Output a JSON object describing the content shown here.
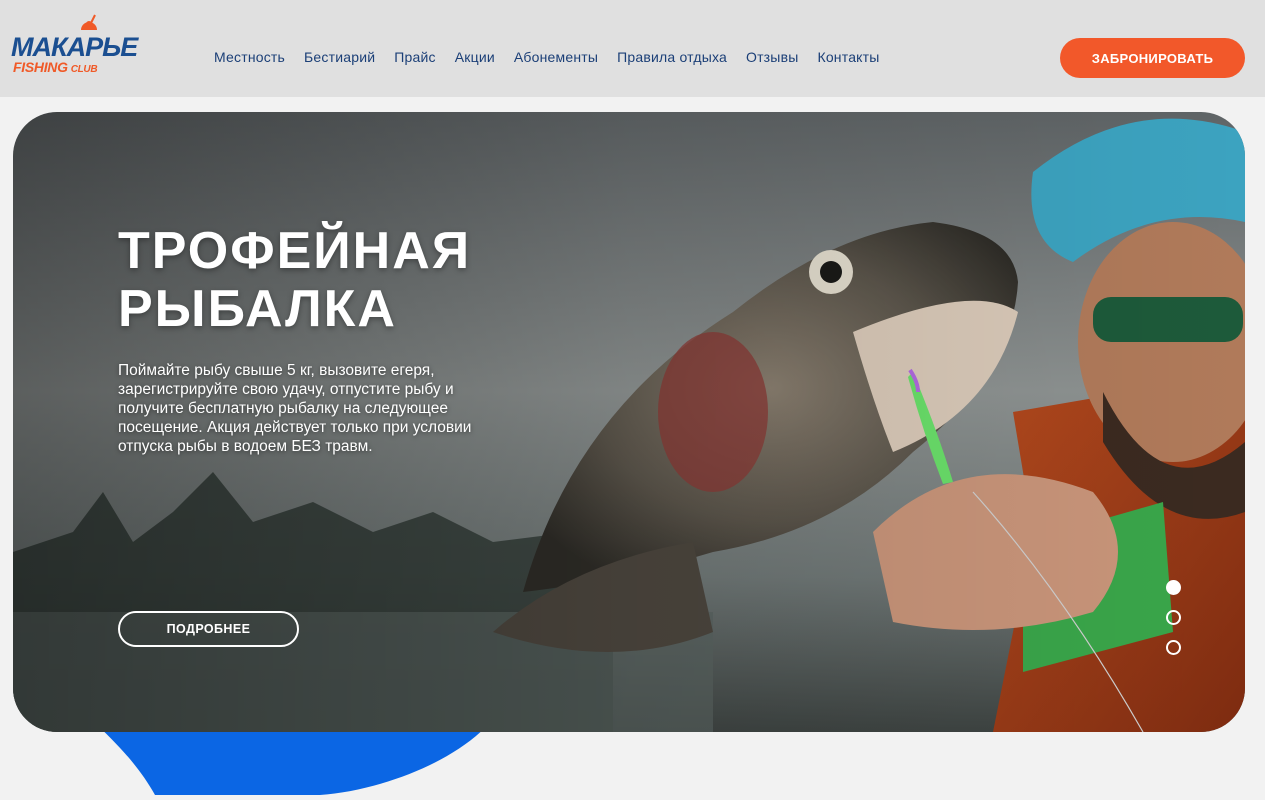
{
  "brand": {
    "name": "МАКАРЬЕ",
    "sub": "FISHING",
    "sub2": "CLUB"
  },
  "nav": [
    {
      "label": "Местность"
    },
    {
      "label": "Бестиарий"
    },
    {
      "label": "Прайс"
    },
    {
      "label": "Акции"
    },
    {
      "label": "Абонементы"
    },
    {
      "label": "Правила отдыха"
    },
    {
      "label": "Отзывы"
    },
    {
      "label": "Контакты"
    }
  ],
  "book_label": "ЗАБРОНИРОВАТЬ",
  "hero": {
    "title_line1": "ТРОФЕЙНАЯ",
    "title_line2": "РЫБАЛКА",
    "text": "Поймайте рыбу свыше 5 кг, вызовите егеря, зарегистрируйте свою удачу, отпустите рыбу и получите бесплатную рыбалку на следующее посещение. Акция действует только при условии отпуска рыбы в водоем БЕЗ травм.",
    "button": "ПОДРОБНЕЕ",
    "slides_total": 3,
    "slide_active": 1
  },
  "colors": {
    "accent": "#f2582a",
    "nav_text": "#1b3f77",
    "blue": "#0b66e4"
  }
}
